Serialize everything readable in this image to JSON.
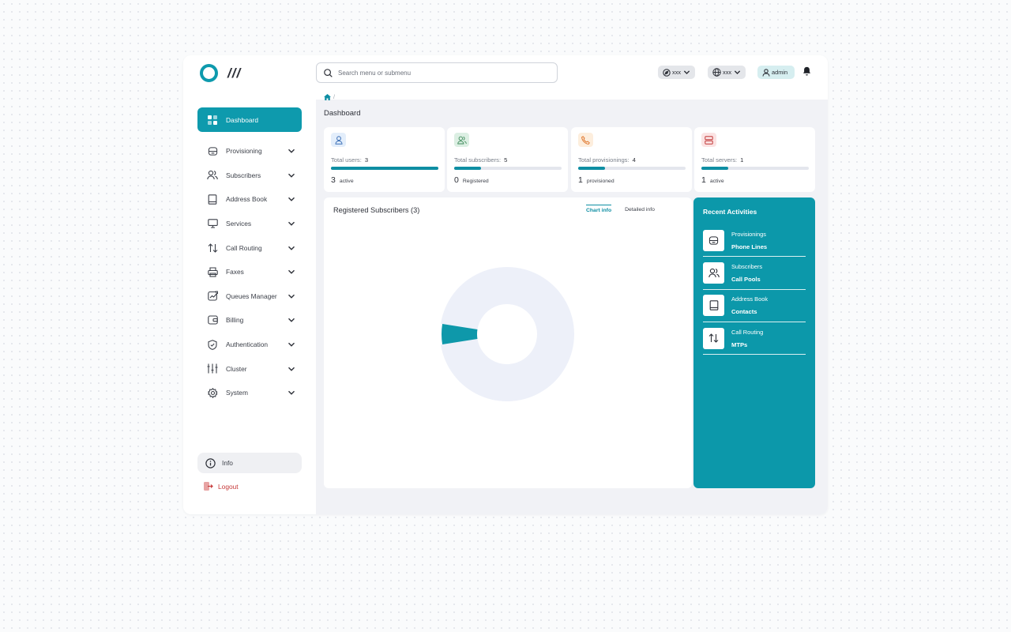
{
  "logo_text": "///",
  "search": {
    "placeholder": "Search menu or submenu"
  },
  "header": {
    "selector_1": "xxx",
    "selector_2": "xxx",
    "user": "admin"
  },
  "breadcrumb": {
    "separator": "/"
  },
  "sidebar": {
    "items": [
      {
        "label": "Dashboard",
        "icon": "dashboard-icon"
      },
      {
        "label": "Provisioning",
        "icon": "database-icon"
      },
      {
        "label": "Subscribers",
        "icon": "users-icon"
      },
      {
        "label": "Address Book",
        "icon": "book-icon"
      },
      {
        "label": "Services",
        "icon": "monitor-icon"
      },
      {
        "label": "Call Routing",
        "icon": "arrows-up-down-icon"
      },
      {
        "label": "Faxes",
        "icon": "printer-icon"
      },
      {
        "label": "Queues Manager",
        "icon": "chart-trend-icon"
      },
      {
        "label": "Billing",
        "icon": "wallet-icon"
      },
      {
        "label": "Authentication",
        "icon": "shield-icon"
      },
      {
        "label": "Cluster",
        "icon": "sliders-icon"
      },
      {
        "label": "System",
        "icon": "gear-icon"
      }
    ],
    "info_label": "Info",
    "logout_label": "Logout"
  },
  "main": {
    "title": "Dashboard",
    "stats": [
      {
        "label": "Total users:",
        "value": "3",
        "footer_value": "3",
        "footer_label": "active",
        "progress": 1.0,
        "icon": "user-icon",
        "icon_bg": "#e3eefb",
        "icon_color": "#3b6fb6"
      },
      {
        "label": "Total subscribers:",
        "value": "5",
        "footer_value": "0",
        "footer_label": "Registered",
        "progress": 0.25,
        "icon": "users-icon",
        "icon_bg": "#dcefe3",
        "icon_color": "#3d8a5a"
      },
      {
        "label": "Total provisionings:",
        "value": "4",
        "footer_value": "1",
        "footer_label": "provisioned",
        "progress": 0.25,
        "icon": "phone-icon",
        "icon_bg": "#fdeedd",
        "icon_color": "#e0782f"
      },
      {
        "label": "Total servers:",
        "value": "1",
        "footer_value": "1",
        "footer_label": "active",
        "progress": 0.25,
        "icon": "server-icon",
        "icon_bg": "#fbe3e3",
        "icon_color": "#c23a3a"
      }
    ],
    "chart_card": {
      "title": "Registered Subscribers (3)",
      "tabs": [
        "Chart info",
        "Detailed info"
      ]
    },
    "activities": {
      "title": "Recent Activities",
      "items": [
        {
          "category": "Provisionings",
          "name": "Phone Lines",
          "icon": "database-icon"
        },
        {
          "category": "Subscribers",
          "name": "Call Pools",
          "icon": "users-icon"
        },
        {
          "category": "Address Book",
          "name": "Contacts",
          "icon": "book-icon"
        },
        {
          "category": "Call Routing",
          "name": "MTPs",
          "icon": "arrows-up-down-icon"
        }
      ]
    }
  },
  "colors": {
    "accent": "#0e9aad",
    "chart_main": "#edf0f9",
    "chart_highlight": "#0e98aa"
  },
  "chart_data": {
    "type": "pie",
    "title": "Registered Subscribers (3)",
    "slices": [
      {
        "value": 0.95
      },
      {
        "value": 0.05
      }
    ]
  }
}
